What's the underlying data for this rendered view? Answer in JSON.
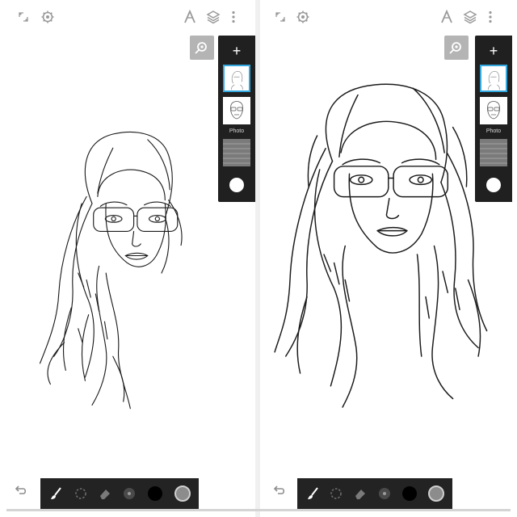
{
  "screens": [
    {
      "id": "left",
      "layers_panel": {
        "add_label": "+",
        "photo_label": "Photo"
      },
      "icons": {
        "fullscreen": "fullscreen-icon",
        "settings": "gear-icon",
        "ruler": "ruler-icon",
        "layers": "layers-icon",
        "menu": "more-vert-icon",
        "reference": "reference-target-icon",
        "undo": "undo-icon",
        "brush": "brush-icon",
        "lasso": "lasso-icon",
        "eraser": "eraser-icon",
        "blend": "blend-icon"
      },
      "colors": {
        "current": "#000000",
        "secondary": "#8c8c8c",
        "toolbar_bg": "#232323",
        "selected_border": "#33a9e0"
      }
    },
    {
      "id": "right",
      "layers_panel": {
        "add_label": "+",
        "photo_label": "Photo"
      },
      "icons": {
        "fullscreen": "fullscreen-icon",
        "settings": "gear-icon",
        "ruler": "ruler-icon",
        "layers": "layers-icon",
        "menu": "more-vert-icon",
        "reference": "reference-target-icon",
        "undo": "undo-icon",
        "brush": "brush-icon",
        "lasso": "lasso-icon",
        "eraser": "eraser-icon",
        "blend": "blend-icon"
      },
      "colors": {
        "current": "#000000",
        "secondary": "#8c8c8c",
        "toolbar_bg": "#232323",
        "selected_border": "#33a9e0"
      }
    }
  ]
}
